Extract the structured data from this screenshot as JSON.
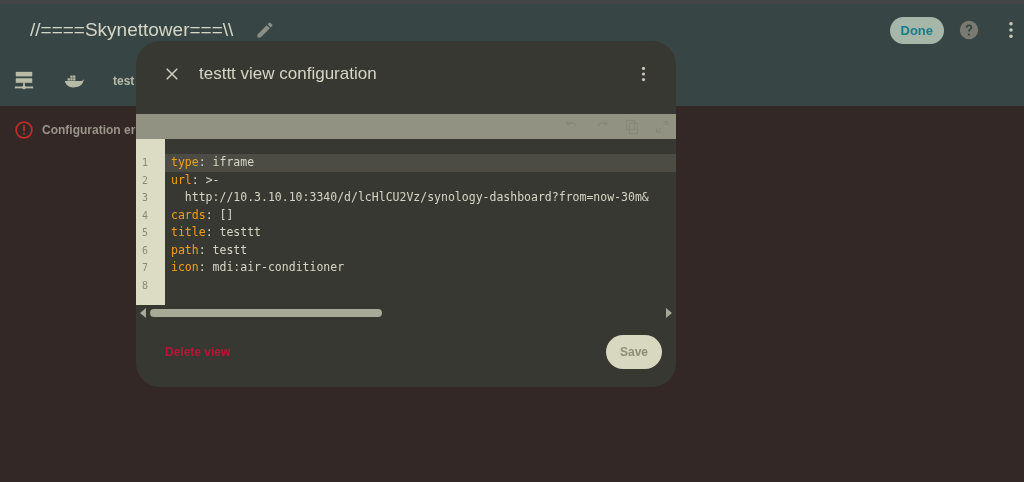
{
  "header": {
    "title": "//====Skynettower===\\\\",
    "done_label": "Done"
  },
  "tabs": [
    {
      "kind": "server"
    },
    {
      "kind": "whale"
    },
    {
      "kind": "text",
      "label": "test"
    }
  ],
  "error": {
    "text": "Configuration er"
  },
  "dialog": {
    "title": "testtt view configuration",
    "lines": [
      {
        "number": "1",
        "key": "type",
        "value": ": iframe",
        "active": true
      },
      {
        "number": "2",
        "key": "url",
        "value": ": >-",
        "active": false
      },
      {
        "number": "3",
        "text": "  http://10.3.10.10:3340/d/lcHlCU2Vz/synology-dashboard?from=now-30m&",
        "active": false
      },
      {
        "number": "4",
        "key": "cards",
        "value": ": []",
        "active": false
      },
      {
        "number": "5",
        "key": "title",
        "value": ": testtt",
        "active": false
      },
      {
        "number": "6",
        "key": "path",
        "value": ": testt",
        "active": false
      },
      {
        "number": "7",
        "key": "icon",
        "value": ": mdi:air-conditioner",
        "active": false
      },
      {
        "number": "8",
        "active": false
      }
    ],
    "delete_label": "Delete view",
    "save_label": "Save",
    "save_disabled": true
  }
}
